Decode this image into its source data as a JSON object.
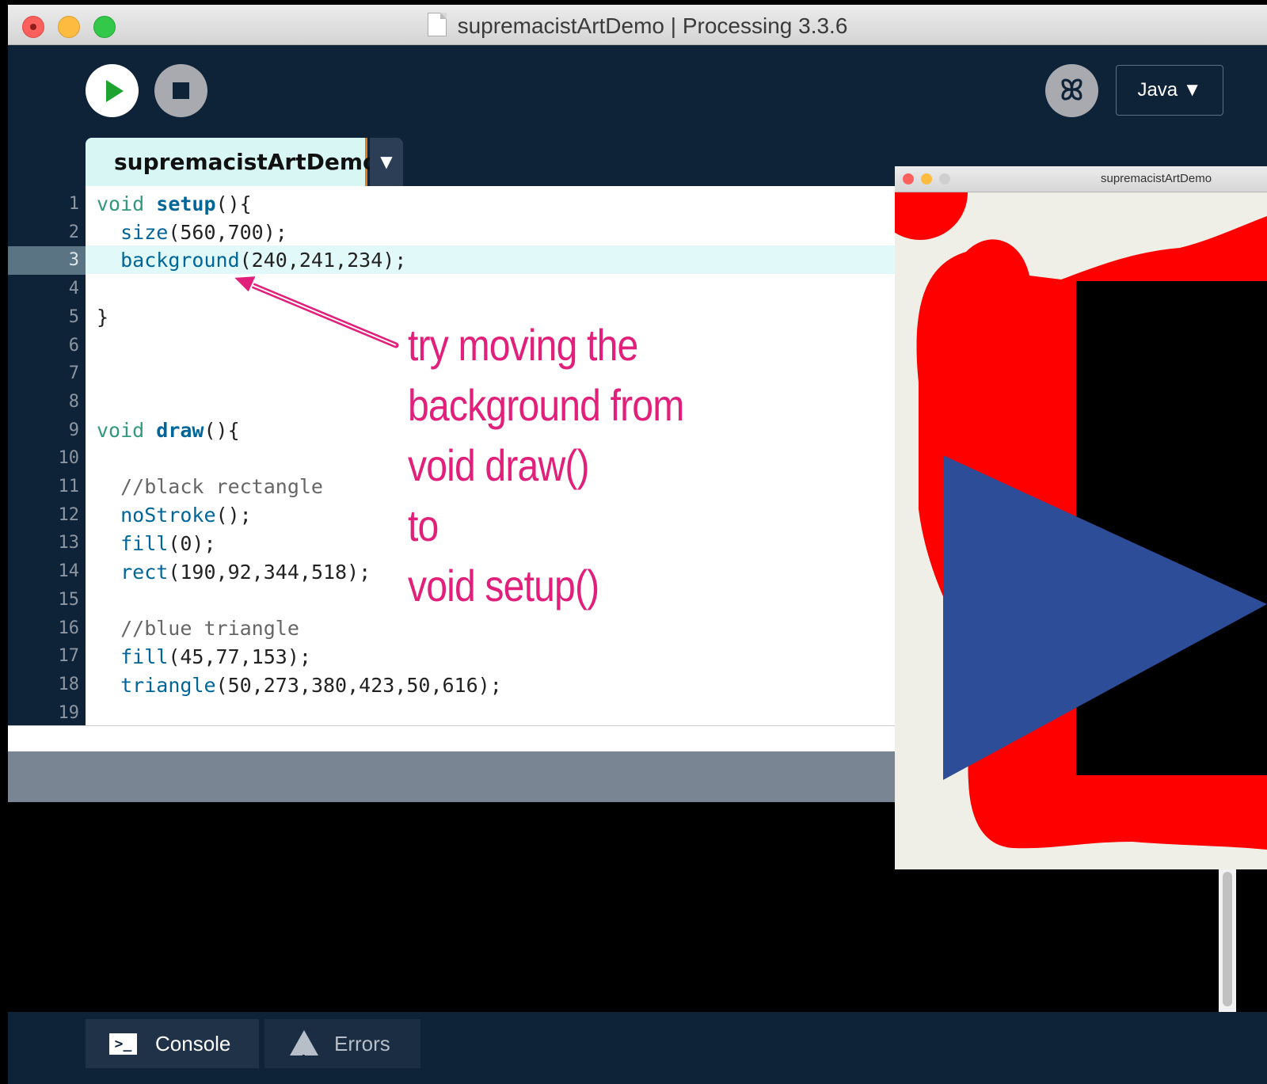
{
  "window": {
    "title": "supremacistArtDemo | Processing 3.3.6"
  },
  "toolbar": {
    "run_label": "Run",
    "stop_label": "Stop",
    "mode_label": "Java ▼"
  },
  "editor": {
    "tab_name": "supremacistArtDemo",
    "tab_menu": "▼",
    "current_line": 3,
    "line_numbers": [
      "1",
      "2",
      "3",
      "4",
      "5",
      "6",
      "7",
      "8",
      "9",
      "10",
      "11",
      "12",
      "13",
      "14",
      "15",
      "16",
      "17",
      "18",
      "19"
    ]
  },
  "code": {
    "l1a": "void ",
    "l1b": "setup",
    "l1c": "(){",
    "l2a": "  ",
    "l2b": "size",
    "l2c": "(560,700);",
    "l3a": "  ",
    "l3b": "background",
    "l3c": "(240,241,234);",
    "l5": "}",
    "l9a": "void ",
    "l9b": "draw",
    "l9c": "(){",
    "l11": "  //black rectangle",
    "l12a": "  ",
    "l12b": "noStroke",
    "l12c": "();",
    "l13a": "  ",
    "l13b": "fill",
    "l13c": "(0);",
    "l14a": "  ",
    "l14b": "rect",
    "l14c": "(190,92,344,518);",
    "l16": "  //blue triangle",
    "l17a": "  ",
    "l17b": "fill",
    "l17c": "(45,77,153);",
    "l18a": "  ",
    "l18b": "triangle",
    "l18c": "(50,273,380,423,50,616);"
  },
  "annotation": {
    "lines": [
      "try moving the",
      "background from",
      "void draw()",
      "to",
      "void setup()"
    ],
    "color": "#e0207a"
  },
  "sketch_window": {
    "title": "supremacistArtDemo",
    "colors": {
      "background": "#efefe8",
      "red": "#ff0000",
      "black": "#000000",
      "blue": "#2d4d99"
    }
  },
  "footer": {
    "console_label": "Console",
    "errors_label": "Errors"
  }
}
